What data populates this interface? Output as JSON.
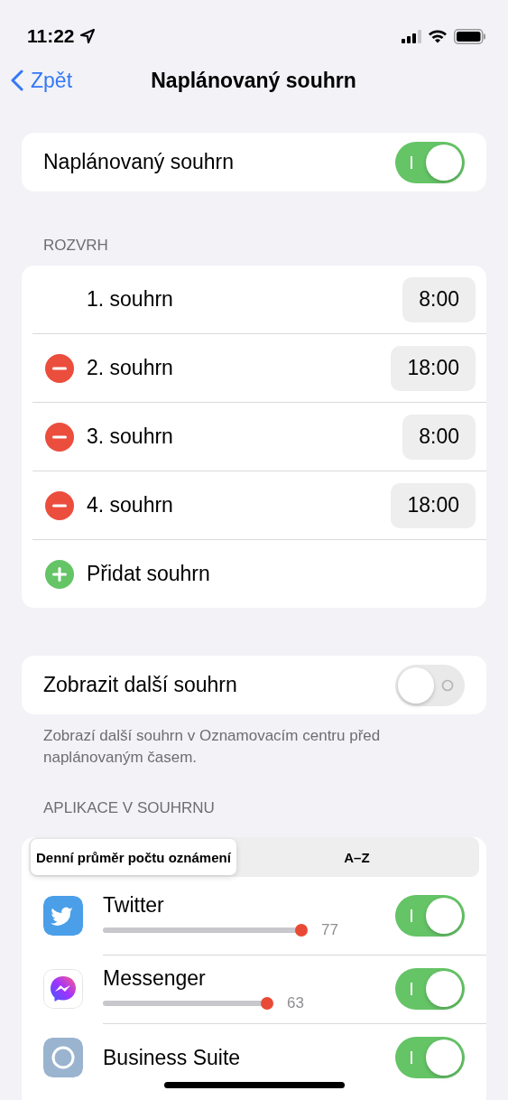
{
  "status_bar": {
    "time": "11:22"
  },
  "nav": {
    "back": "Zpět",
    "title": "Naplánovaný souhrn"
  },
  "main_toggle": {
    "label": "Naplánovaný souhrn",
    "on": true
  },
  "schedule": {
    "header": "ROZVRH",
    "rows": [
      {
        "kind": "fixed",
        "label": "1. souhrn",
        "time": "8:00"
      },
      {
        "kind": "removable",
        "label": "2. souhrn",
        "time": "18:00"
      },
      {
        "kind": "removable",
        "label": "3. souhrn",
        "time": "8:00"
      },
      {
        "kind": "removable",
        "label": "4. souhrn",
        "time": "18:00"
      },
      {
        "kind": "add",
        "label": "Přidat souhrn"
      }
    ]
  },
  "next_summary": {
    "label": "Zobrazit další souhrn",
    "on": false,
    "footnote": "Zobrazí další souhrn v Oznamovacím centru před naplánovaným časem."
  },
  "apps": {
    "header": "APLIKACE V SOUHRNU",
    "segments": [
      {
        "label": "Denní průměr počtu oznámení",
        "selected": true
      },
      {
        "label": "A–Z",
        "selected": false
      }
    ],
    "items": [
      {
        "name": "Twitter",
        "count": "77",
        "on": true
      },
      {
        "name": "Messenger",
        "count": "63",
        "on": true
      },
      {
        "name": "Business Suite",
        "on": true
      }
    ]
  }
}
